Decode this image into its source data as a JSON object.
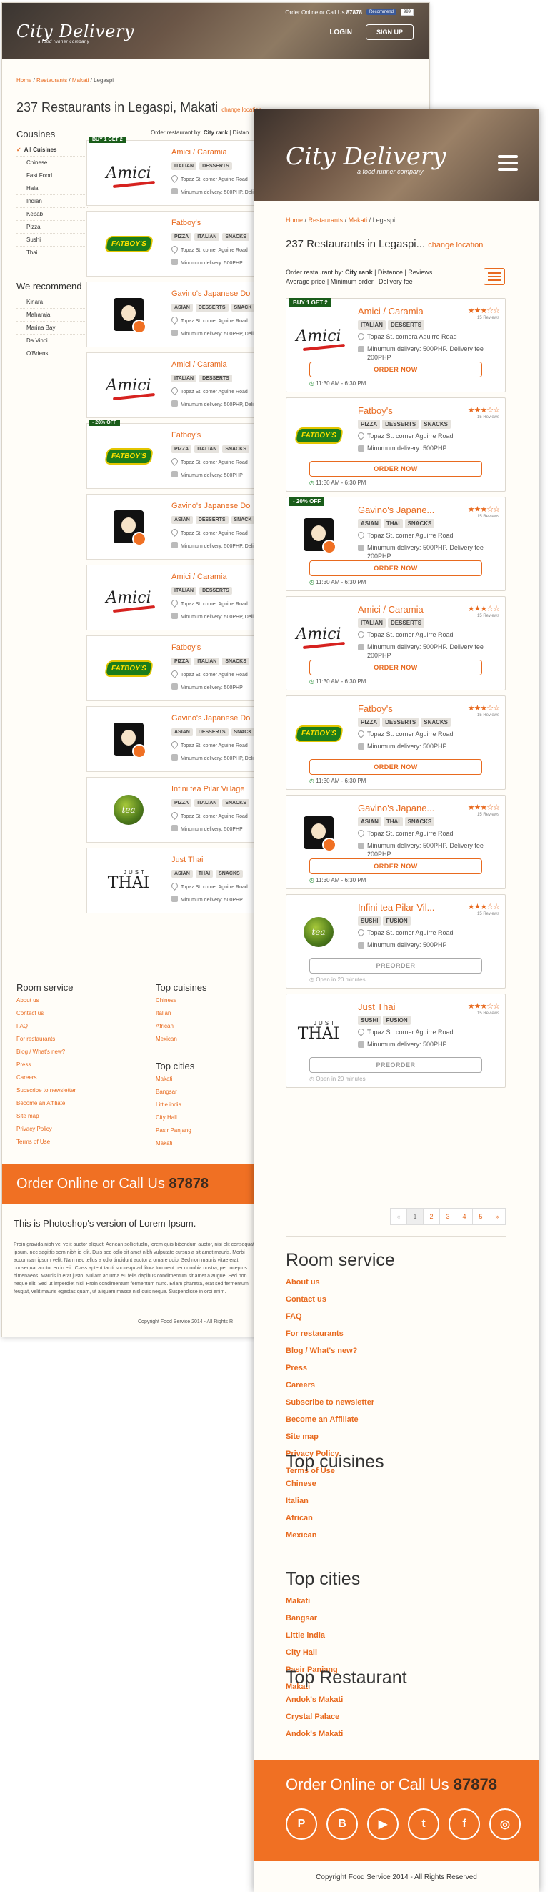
{
  "desktop": {
    "topbar_text": "Order Online or Call Us",
    "topbar_phone": "87878",
    "fb_label": "Recommend",
    "fb_count": "999",
    "logo": "City Delivery",
    "tagline": "a food runner company",
    "login": "LOGIN",
    "signup": "SIGN UP",
    "breadcrumb": [
      "Home",
      "Restaurants",
      "Makati",
      "Legaspi"
    ],
    "title": "237 Restaurants in Legaspi, Makati",
    "change_location": "change location",
    "order_prefix": "Order restaurant by:",
    "order_rank": "City rank",
    "order_rest": "| Distan",
    "cuisines_title": "Cousines",
    "cuisines": [
      "All Cuisines",
      "Chinese",
      "Fast Food",
      "Halal",
      "Indian",
      "Kebab",
      "Pizza",
      "Sushi",
      "Thai"
    ],
    "recommend_title": "We recommend",
    "recommend": [
      "Kinara",
      "Maharaja",
      "Marina Bay",
      "Da Vinci",
      "O'Briens"
    ],
    "restaurants": [
      {
        "badge": "BUY 1 GET 2",
        "name": "Amici / Caramia",
        "tags": [
          "ITALIAN",
          "DESSERTS"
        ],
        "address": "Topaz St. corner Aguirre Road",
        "min": "Minumum delivery: 500PHP, Deli",
        "logo": "amici"
      },
      {
        "badge": "",
        "name": "Fatboy's",
        "tags": [
          "PIZZA",
          "ITALIAN",
          "SNACKS"
        ],
        "address": "Topaz St. corner Aguirre Road",
        "min": "Minumum delivery: 500PHP",
        "logo": "fatboy"
      },
      {
        "badge": "",
        "name": "Gavino's Japanese Do",
        "tags": [
          "ASIAN",
          "DESSERTS",
          "SNACK"
        ],
        "address": "Topaz St. corner Aguirre Road",
        "min": "Minumum delivery: 500PHP, Deli",
        "logo": "gavino"
      },
      {
        "badge": "",
        "name": "Amici / Caramia",
        "tags": [
          "ITALIAN",
          "DESSERTS"
        ],
        "address": "Topaz St. corner Aguirre Road",
        "min": "Minumum delivery: 500PHP, Deli",
        "logo": "amici"
      },
      {
        "badge": "- 20% OFF",
        "name": "Fatboy's",
        "tags": [
          "PIZZA",
          "ITALIAN",
          "SNACKS"
        ],
        "address": "Topaz St. corner Aguirre Road",
        "min": "Minumum delivery: 500PHP",
        "logo": "fatboy"
      },
      {
        "badge": "",
        "name": "Gavino's Japanese Do",
        "tags": [
          "ASIAN",
          "DESSERTS",
          "SNACK"
        ],
        "address": "Topaz St. corner Aguirre Road",
        "min": "Minumum delivery: 500PHP, Deli",
        "logo": "gavino"
      },
      {
        "badge": "",
        "name": "Amici / Caramia",
        "tags": [
          "ITALIAN",
          "DESSERTS"
        ],
        "address": "Topaz St. corner Aguirre Road",
        "min": "Minumum delivery: 500PHP, Deli",
        "logo": "amici"
      },
      {
        "badge": "",
        "name": "Fatboy's",
        "tags": [
          "PIZZA",
          "ITALIAN",
          "SNACKS"
        ],
        "address": "Topaz St. corner Aguirre Road",
        "min": "Minumum delivery: 500PHP",
        "logo": "fatboy"
      },
      {
        "badge": "",
        "name": "Gavino's Japanese Do",
        "tags": [
          "ASIAN",
          "DESSERTS",
          "SNACK"
        ],
        "address": "Topaz St. corner Aguirre Road",
        "min": "Minumum delivery: 500PHP, Deli",
        "logo": "gavino"
      },
      {
        "badge": "",
        "name": "Infini tea Pilar Village",
        "tags": [
          "PIZZA",
          "ITALIAN",
          "SNACKS"
        ],
        "address": "Topaz St. corner Aguirre Road",
        "min": "Minumum delivery: 500PHP",
        "logo": "infini"
      },
      {
        "badge": "",
        "name": "Just Thai",
        "tags": [
          "ASIAN",
          "THAI",
          "SNACKS"
        ],
        "address": "Topaz St. corner Aguirre Road",
        "min": "Minumum delivery: 500PHP",
        "logo": "justthai"
      }
    ],
    "footer": {
      "room_title": "Room service",
      "room_links": [
        "About us",
        "Contact us",
        "FAQ",
        "For restaurants",
        "Blog / What's new?",
        "Press",
        "Careers",
        "Subscribe to newsletter",
        "Become an Affiliate",
        "Site map",
        "Privacy Policy",
        "Terms of Use"
      ],
      "cuisines_title": "Top cuisines",
      "cuisines_links": [
        "Chinese",
        "Italian",
        "African",
        "Mexican"
      ],
      "cities_title": "Top cities",
      "cities_links": [
        "Makati",
        "Bangsar",
        "Little india",
        "City Hall",
        "Pasir Panjang",
        "Makati"
      ]
    },
    "orange_text": "Order Online or Call Us",
    "orange_phone": "87878",
    "lorem_title": "This is Photoshop's version  of Lorem Ipsum.",
    "lorem_body": "Proin gravida nibh vel velit auctor aliquet. Aenean sollicitudin, lorem quis bibendum auctor, nisi elit consequat ipsum, nec sagittis sem nibh id elit. Duis sed odio sit amet nibh vulputate cursus a sit amet mauris. Morbi accumsan ipsum velit. Nam nec tellus a odio tincidunt auctor a ornare odio. Sed non  mauris vitae erat consequat auctor eu in elit. Class aptent taciti sociosqu ad litora torquent per conubia nostra, per inceptos himenaeos. Mauris in erat justo. Nullam ac urna eu felis dapibus condimentum sit amet a augue. Sed non neque elit. Sed ut imperdiet nisi. Proin condimentum fermentum nunc. Etiam pharetra, erat sed fermentum feugiat, velit mauris egestas quam, ut aliquam massa nisl quis neque. Suspendisse in orci enim.",
    "copyright": "Copyright Food Service 2014 - All Rights R"
  },
  "mobile": {
    "logo": "City Delivery",
    "tagline": "a food runner company",
    "breadcrumb": [
      "Home",
      "Restaurants",
      "Makati",
      "Legaspi"
    ],
    "title": "237 Restaurants in Legaspi...",
    "change_location": "change location",
    "order_prefix": "Order restaurant by:",
    "order_rank": "City rank",
    "order_rest": "| Distance | Reviews",
    "order_line2": "Average price | Minimum order | Delivery fee",
    "restaurants": [
      {
        "badge": "BUY 1 GET 2",
        "name": "Amici / Caramia",
        "stars": "★★★☆☆",
        "reviews": "15 Reviews",
        "tags": [
          "ITALIAN",
          "DESSERTS"
        ],
        "address": "Topaz St. cornera Aguirre Road",
        "min": "Minumum delivery: 500PHP. Delivery fee 200PHP",
        "button": "ORDER NOW",
        "hours": "11:30 AM - 6:30 PM",
        "open": true,
        "logo": "amici"
      },
      {
        "badge": "",
        "name": "Fatboy's",
        "stars": "★★★☆☆",
        "reviews": "15 Reviews",
        "tags": [
          "PIZZA",
          "DESSERTS",
          "SNACKS"
        ],
        "address": "Topaz St. corner Aguirre Road",
        "min": "Minumum delivery: 500PHP",
        "button": "ORDER NOW",
        "hours": "11:30 AM - 6:30 PM",
        "open": true,
        "logo": "fatboy"
      },
      {
        "badge": "- 20% OFF",
        "name": "Gavino's Japane...",
        "stars": "★★★☆☆",
        "reviews": "15 Reviews",
        "tags": [
          "ASIAN",
          "THAI",
          "SNACKS"
        ],
        "address": "Topaz St. corner Aguirre Road",
        "min": "Minumum delivery: 500PHP. Delivery fee 200PHP",
        "button": "ORDER NOW",
        "hours": "11:30 AM - 6:30 PM",
        "open": true,
        "logo": "gavino"
      },
      {
        "badge": "",
        "name": "Amici / Caramia",
        "stars": "★★★☆☆",
        "reviews": "15 Reviews",
        "tags": [
          "ITALIAN",
          "DESSERTS"
        ],
        "address": "Topaz St. corner Aguirre Road",
        "min": "Minumum delivery: 500PHP. Delivery fee 200PHP",
        "button": "ORDER NOW",
        "hours": "11:30 AM - 6:30 PM",
        "open": true,
        "logo": "amici"
      },
      {
        "badge": "",
        "name": "Fatboy's",
        "stars": "★★★☆☆",
        "reviews": "15 Reviews",
        "tags": [
          "PIZZA",
          "DESSERTS",
          "SNACKS"
        ],
        "address": "Topaz St. corner Aguirre Road",
        "min": "Minumum delivery: 500PHP",
        "button": "ORDER NOW",
        "hours": "11:30 AM - 6:30 PM",
        "open": true,
        "logo": "fatboy"
      },
      {
        "badge": "",
        "name": "Gavino's Japane...",
        "stars": "★★★☆☆",
        "reviews": "15 Reviews",
        "tags": [
          "ASIAN",
          "THAI",
          "SNACKS"
        ],
        "address": "Topaz St. corner Aguirre Road",
        "min": "Minumum delivery: 500PHP. Delivery fee 200PHP",
        "button": "ORDER NOW",
        "hours": "11:30 AM - 6:30 PM",
        "open": true,
        "logo": "gavino"
      },
      {
        "badge": "",
        "name": "Infini tea Pilar Vil...",
        "stars": "★★★☆☆",
        "reviews": "15 Reviews",
        "tags": [
          "SUSHI",
          "FUSION"
        ],
        "address": "Topaz St. corner Aguirre Road",
        "min": "Minumum delivery: 500PHP",
        "button": "PREORDER",
        "hours": "Open in 20 minutes",
        "open": false,
        "logo": "infini"
      },
      {
        "badge": "",
        "name": "Just Thai",
        "stars": "★★★☆☆",
        "reviews": "15 Reviews",
        "tags": [
          "SUSHI",
          "FUSION"
        ],
        "address": "Topaz St. corner Aguirre Road",
        "min": "Minumum delivery: 500PHP",
        "button": "PREORDER",
        "hours": "Open in 20 minutes",
        "open": false,
        "logo": "justthai"
      }
    ],
    "pager": [
      "«",
      "1",
      "2",
      "3",
      "4",
      "5",
      "»"
    ],
    "pager_active": "1",
    "footer": {
      "room_title": "Room service",
      "room_links": [
        "About us",
        "Contact us",
        "FAQ",
        "For restaurants",
        "Blog / What's new?",
        "Press",
        "Careers",
        "Subscribe to newsletter",
        "Become an Affiliate",
        "Site map",
        "Privacy Policy",
        "Terms of Use"
      ],
      "cuisines_title": "Top cuisines",
      "cuisines_links": [
        "Chinese",
        "Italian",
        "African",
        "Mexican"
      ],
      "cities_title": "Top cities",
      "cities_links": [
        "Makati",
        "Bangsar",
        "Little india",
        "City Hall",
        "Pasir Panjang",
        "Makati"
      ],
      "restaurants_title": "Top Restaurant",
      "restaurants_links": [
        "Andok's Makati",
        "Crystal Palace",
        "Andok's Makati"
      ]
    },
    "orange_text": "Order Online or Call Us",
    "orange_phone": "87878",
    "social": [
      {
        "icon": "pinterest-icon",
        "glyph": "P"
      },
      {
        "icon": "blogger-icon",
        "glyph": "B"
      },
      {
        "icon": "youtube-icon",
        "glyph": "▶"
      },
      {
        "icon": "twitter-icon",
        "glyph": "t"
      },
      {
        "icon": "facebook-icon",
        "glyph": "f"
      },
      {
        "icon": "instagram-icon",
        "glyph": "◎"
      }
    ],
    "copyright": "Copyright Food Service 2014 - All Rights Reserved"
  },
  "colors": {
    "accent": "#f07023",
    "link": "#e86a1f",
    "badge": "#1a5d1a"
  }
}
